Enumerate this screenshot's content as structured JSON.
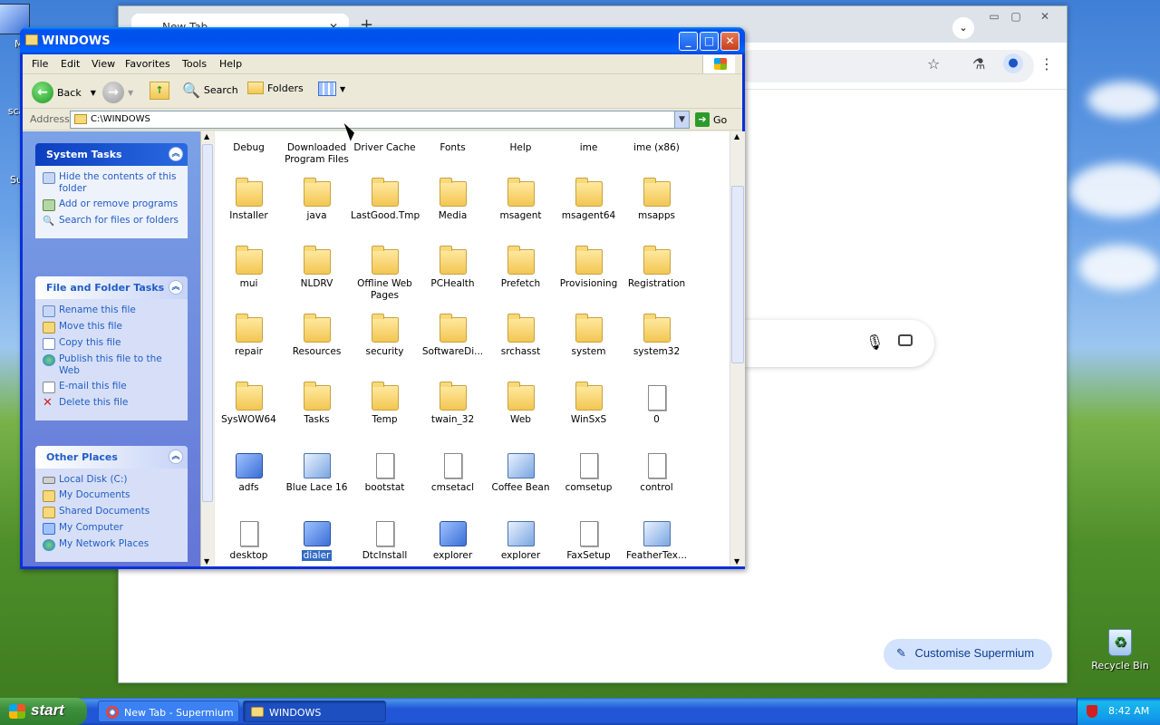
{
  "desktop": {
    "icons": [
      {
        "label": "My",
        "icon": "my-computer-icon"
      },
      {
        "label": "sca",
        "icon": "scanner-icon"
      },
      {
        "label": "Su",
        "icon": "supermium-icon"
      },
      {
        "label": "Recycle Bin",
        "icon": "recycle-bin-icon"
      }
    ]
  },
  "chrome": {
    "tab_title": "New Tab",
    "customise_label": "Customise Supermium"
  },
  "explorer": {
    "title": "WINDOWS",
    "menu": [
      "File",
      "Edit",
      "View",
      "Favorites",
      "Tools",
      "Help"
    ],
    "toolbar": {
      "back": "Back",
      "search": "Search",
      "folders": "Folders"
    },
    "address": {
      "label": "Address",
      "value": "C:\\WINDOWS",
      "go": "Go"
    },
    "system_tasks": {
      "title": "System Tasks",
      "items": [
        "Hide the contents of this folder",
        "Add or remove programs",
        "Search for files or folders"
      ]
    },
    "file_folder_tasks": {
      "title": "File and Folder Tasks",
      "items": [
        "Rename this file",
        "Move this file",
        "Copy this file",
        "Publish this file to the Web",
        "E-mail this file",
        "Delete this file"
      ]
    },
    "other_places": {
      "title": "Other Places",
      "items": [
        "Local Disk (C:)",
        "My Documents",
        "Shared Documents",
        "My Computer",
        "My Network Places"
      ]
    },
    "files": [
      {
        "name": "Debug",
        "type": "folder"
      },
      {
        "name": "Downloaded Program Files",
        "type": "folder"
      },
      {
        "name": "Driver Cache",
        "type": "folder"
      },
      {
        "name": "Fonts",
        "type": "folder"
      },
      {
        "name": "Help",
        "type": "folder"
      },
      {
        "name": "ime",
        "type": "folder"
      },
      {
        "name": "ime (x86)",
        "type": "folder"
      },
      {
        "name": "Installer",
        "type": "folder"
      },
      {
        "name": "java",
        "type": "folder"
      },
      {
        "name": "LastGood.Tmp",
        "type": "folder"
      },
      {
        "name": "Media",
        "type": "folder"
      },
      {
        "name": "msagent",
        "type": "folder"
      },
      {
        "name": "msagent64",
        "type": "folder"
      },
      {
        "name": "msapps",
        "type": "folder"
      },
      {
        "name": "mui",
        "type": "folder"
      },
      {
        "name": "NLDRV",
        "type": "folder"
      },
      {
        "name": "Offline Web Pages",
        "type": "special"
      },
      {
        "name": "PCHealth",
        "type": "folder"
      },
      {
        "name": "Prefetch",
        "type": "folder"
      },
      {
        "name": "Provisioning",
        "type": "folder"
      },
      {
        "name": "Registration",
        "type": "folder"
      },
      {
        "name": "repair",
        "type": "folder"
      },
      {
        "name": "Resources",
        "type": "folder"
      },
      {
        "name": "security",
        "type": "folder"
      },
      {
        "name": "SoftwareDi...",
        "type": "folder"
      },
      {
        "name": "srchasst",
        "type": "folder"
      },
      {
        "name": "system",
        "type": "folder"
      },
      {
        "name": "system32",
        "type": "folder"
      },
      {
        "name": "SysWOW64",
        "type": "folder"
      },
      {
        "name": "Tasks",
        "type": "folder"
      },
      {
        "name": "Temp",
        "type": "folder"
      },
      {
        "name": "twain_32",
        "type": "folder"
      },
      {
        "name": "Web",
        "type": "folder"
      },
      {
        "name": "WinSxS",
        "type": "folder"
      },
      {
        "name": "0",
        "type": "doc"
      },
      {
        "name": "adfs",
        "type": "exe"
      },
      {
        "name": "Blue Lace 16",
        "type": "img"
      },
      {
        "name": "bootstat",
        "type": "doc"
      },
      {
        "name": "cmsetacl",
        "type": "doc"
      },
      {
        "name": "Coffee Bean",
        "type": "img"
      },
      {
        "name": "comsetup",
        "type": "doc"
      },
      {
        "name": "control",
        "type": "doc"
      },
      {
        "name": "desktop",
        "type": "doc"
      },
      {
        "name": "dialer",
        "type": "exe",
        "selected": true
      },
      {
        "name": "DtcInstall",
        "type": "doc"
      },
      {
        "name": "explorer",
        "type": "exe"
      },
      {
        "name": "explorer",
        "type": "img"
      },
      {
        "name": "FaxSetup",
        "type": "doc"
      },
      {
        "name": "FeatherTex...",
        "type": "img"
      }
    ]
  },
  "taskbar": {
    "start": "start",
    "items": [
      "New Tab - Supermium",
      "WINDOWS"
    ],
    "clock": "8:42 AM"
  }
}
